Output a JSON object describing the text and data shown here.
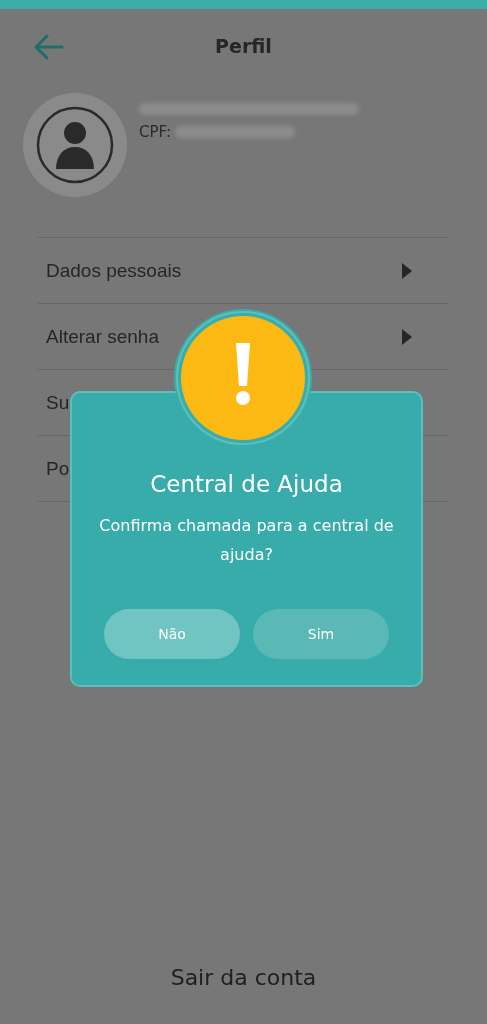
{
  "header": {
    "title": "Perfil"
  },
  "profile": {
    "cpf_label": "CPF:"
  },
  "menu": [
    {
      "label": "Dados pessoais",
      "arrow": true
    },
    {
      "label": "Alterar senha",
      "arrow": true
    },
    {
      "label": "Su"
    },
    {
      "label": "Po"
    }
  ],
  "dialog": {
    "title": "Central de Ajuda",
    "message": "Confirma chamada para a central de ajuda?",
    "buttons": [
      {
        "label": "Não",
        "kind": "cancel"
      },
      {
        "label": "Sim",
        "kind": "confirm"
      }
    ]
  },
  "logout": {
    "label": "Sair da conta"
  }
}
